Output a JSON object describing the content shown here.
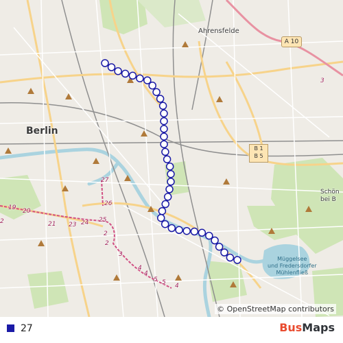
{
  "map": {
    "labels": {
      "city": "Berlin",
      "district": "Ahrensfelde",
      "east_line1": "Schön",
      "east_line2": "bei B",
      "lake_line1": "Müggelsee",
      "lake_line2": "und Fredersdorfer",
      "lake_line3": "Mühlenfließ"
    },
    "shields": {
      "b_line1": "B 1",
      "b_line2": "B 5",
      "autobahn": "A 10"
    },
    "route_numbers": [
      "27",
      "26",
      "25",
      "24",
      "23",
      "21",
      "20",
      "19",
      "2",
      "2",
      "3",
      "4",
      "4",
      "5",
      "5",
      "4",
      "3",
      "2"
    ],
    "attribution": "© OpenStreetMap contributors",
    "route_color": "#1a1aa6",
    "stop_count": 38
  },
  "legend": {
    "route_label": "27",
    "swatch_color": "#1a1aa6"
  },
  "brand": {
    "part1": "Bus",
    "part2": "Maps"
  }
}
